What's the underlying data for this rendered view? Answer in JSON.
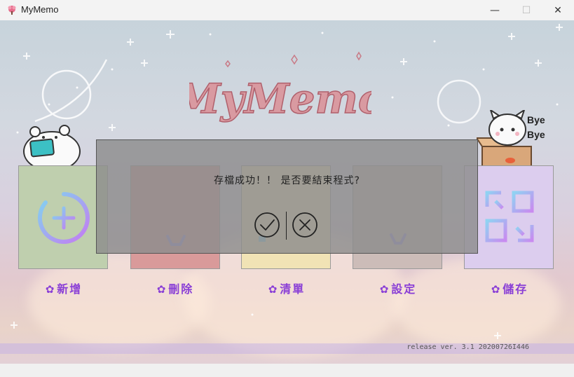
{
  "window": {
    "title": "MyMemo",
    "minimize_glyph": "—",
    "maximize_glyph": "☐",
    "close_glyph": "✕"
  },
  "logo": {
    "text": "MyMemo"
  },
  "characters": {
    "bye_text": "Bye\nBye"
  },
  "cards": [
    {
      "label": "新增",
      "icon": "plus-circle-icon",
      "color": "#bfcfae"
    },
    {
      "label": "刪除",
      "icon": "delete-icon",
      "color": "#d99a9a"
    },
    {
      "label": "清單",
      "icon": "list-icon",
      "color": "#f1e3b5"
    },
    {
      "label": "設定",
      "icon": "settings-icon",
      "color": "#ccbcb8"
    },
    {
      "label": "儲存",
      "icon": "save-icon",
      "color": "#dccdee"
    }
  ],
  "dialog": {
    "message": "存檔成功！！ 是否要結束程式?",
    "confirm": "check-icon",
    "cancel": "x-icon"
  },
  "footer": {
    "version": "release ver. 3.1 20200726I446"
  },
  "colors": {
    "label": "#8a3fd6",
    "logo": "#c97a86",
    "dialog_bg": "#8c8c8c"
  }
}
